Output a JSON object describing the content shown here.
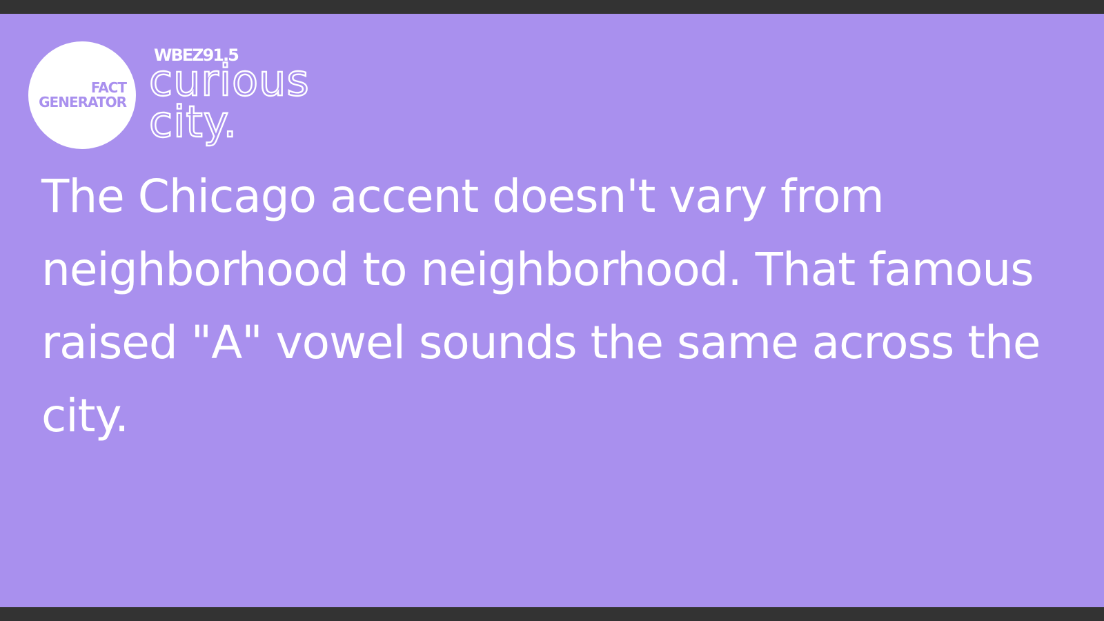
{
  "badge": {
    "line1": "FACT",
    "line2": "GENERATOR"
  },
  "logo": {
    "station": "WBEZ91.5",
    "wordmark_line1": "curious",
    "wordmark_line2": "city."
  },
  "fact": {
    "text": "The Chicago accent doesn't vary from neighborhood to neighborhood. That famous raised \"A\" vowel sounds the same across the city."
  },
  "colors": {
    "background": "#A990EE",
    "frame": "#333333",
    "text": "#FFFFFF"
  }
}
